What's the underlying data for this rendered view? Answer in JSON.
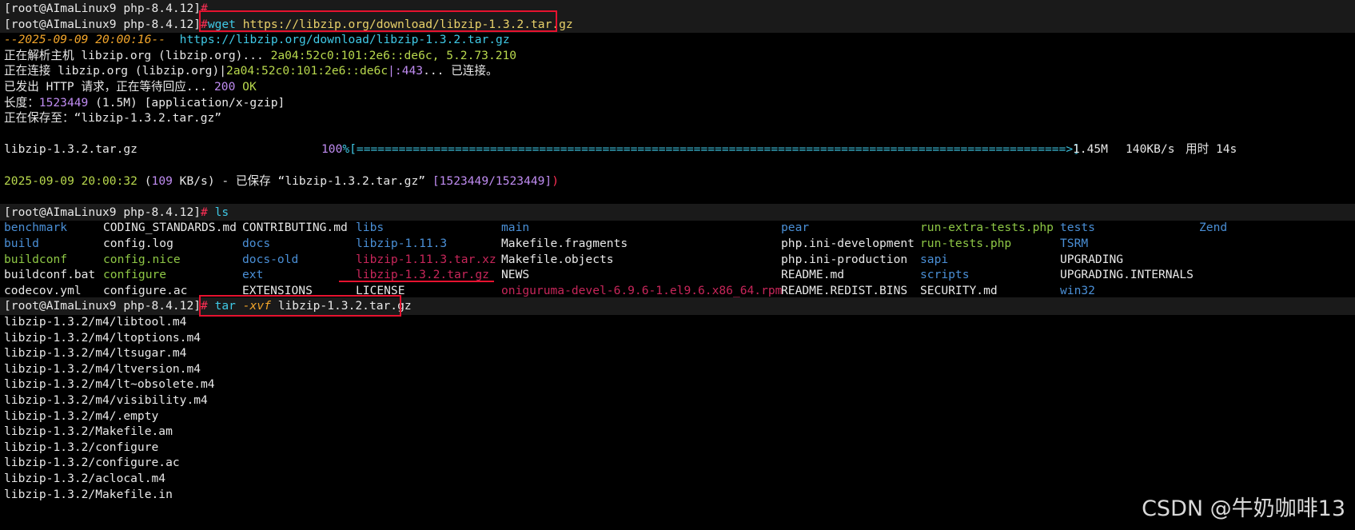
{
  "prompt": "[root@AImaLinux9 php-8.4.12]",
  "hash": "#",
  "wget": {
    "cmd": "wget",
    "url": "https://libzip.org/download/libzip-1.3.2.tar.gz",
    "start_time": "--2025-09-09 20:00:16--",
    "start_url": "https://libzip.org/download/libzip-1.3.2.tar.gz",
    "resolve_prefix": "正在解析主机 libzip.org (libzip.org)... ",
    "resolve_addrs": "2a04:52c0:101:2e6::de6c, 5.2.73.210",
    "connect_prefix": "正在连接 libzip.org (libzip.org)|",
    "connect_addr": "2a04:52c0:101:2e6::de6c",
    "connect_port": "|:443",
    "connect_suffix": "... 已连接。",
    "http_prefix": "已发出 HTTP 请求，正在等待回应... ",
    "http_code": "200",
    "http_ok": "OK",
    "length_label": "长度：",
    "length_bytes": "1523449",
    "length_human": "(1.5M)",
    "length_type": "[application/x-gzip]",
    "saving": "正在保存至：“libzip-1.3.2.tar.gz”",
    "progress_file": "libzip-1.3.2.tar.gz",
    "progress_pct": "100",
    "progress_bar": "%[=====================================================================================================>]",
    "progress_size": "1.45M",
    "progress_speed": "140KB/s",
    "progress_time": "用时 14s",
    "done_time": "2025-09-09 20:00:32",
    "done_speed_open": "(",
    "done_speed_num": "109",
    "done_speed_unit": " KB/s)",
    "done_saved": " - 已保存 “libzip-1.3.2.tar.gz” ",
    "done_bytes": "[1523449/1523449]",
    "done_close": ")"
  },
  "ls": {
    "cmd": "ls",
    "rows": [
      [
        "benchmark",
        "CODING_STANDARDS.md",
        "CONTRIBUTING.md",
        "libs",
        "main",
        "pear",
        "run-extra-tests.php",
        "tests",
        "Zend"
      ],
      [
        "build",
        "config.log",
        "docs",
        "libzip-1.11.3",
        "Makefile.fragments",
        "php.ini-development",
        "run-tests.php",
        "TSRM",
        ""
      ],
      [
        "buildconf",
        "config.nice",
        "docs-old",
        "libzip-1.11.3.tar.xz",
        "Makefile.objects",
        "php.ini-production",
        "sapi",
        "UPGRADING",
        ""
      ],
      [
        "buildconf.bat",
        "configure",
        "ext",
        "libzip-1.3.2.tar.gz",
        "NEWS",
        "README.md",
        "scripts",
        "UPGRADING.INTERNALS",
        ""
      ],
      [
        "codecov.yml",
        "configure.ac",
        "EXTENSIONS",
        "LICENSE",
        "oniguruma-devel-6.9.6-1.el9.6.x86_64.rpm",
        "README.REDIST.BINS",
        "SECURITY.md",
        "win32",
        ""
      ]
    ]
  },
  "tar": {
    "cmd": "tar",
    "flags": "-xvf",
    "arg": "libzip-1.3.2.tar.gz",
    "output": [
      "libzip-1.3.2/m4/libtool.m4",
      "libzip-1.3.2/m4/ltoptions.m4",
      "libzip-1.3.2/m4/ltsugar.m4",
      "libzip-1.3.2/m4/ltversion.m4",
      "libzip-1.3.2/m4/lt~obsolete.m4",
      "libzip-1.3.2/m4/visibility.m4",
      "libzip-1.3.2/m4/.empty",
      "libzip-1.3.2/Makefile.am",
      "libzip-1.3.2/configure",
      "libzip-1.3.2/configure.ac",
      "libzip-1.3.2/aclocal.m4",
      "libzip-1.3.2/Makefile.in"
    ]
  },
  "watermark": "CSDN @牛奶咖啡13",
  "colors": {
    "background": "#000000",
    "highlight": "#e6122f",
    "url": "#3fc9e6",
    "directory": "#4a8fd6",
    "executable": "#8ec745",
    "archive": "#c8265a"
  }
}
